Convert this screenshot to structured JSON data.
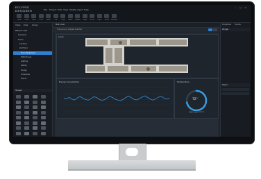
{
  "app": {
    "logo": [
      "ECLYPSE",
      "DESIGNER"
    ],
    "menu": [
      "File",
      "Project",
      "Edit",
      "View",
      "Modify",
      "Insert",
      "Help"
    ],
    "toolbar": [
      {
        "label": "New",
        "icon": "new-file-icon"
      },
      {
        "label": "Open",
        "icon": "open-folder-icon"
      },
      {
        "label": "Save",
        "icon": "save-icon"
      },
      {
        "label": "Undo",
        "icon": "undo-icon"
      },
      {
        "label": "Redo",
        "icon": "redo-icon"
      },
      {
        "label": "Cut",
        "icon": "cut-icon"
      },
      {
        "label": "Copy",
        "icon": "copy-icon"
      },
      {
        "label": "Paste",
        "icon": "paste-icon"
      },
      {
        "label": "Delete",
        "icon": "delete-icon"
      },
      {
        "label": "Align",
        "icon": "align-icon"
      },
      {
        "label": "Group",
        "icon": "group-icon"
      },
      {
        "label": "Layer",
        "icon": "layer-icon"
      },
      {
        "label": "Zoom",
        "icon": "zoom-icon"
      },
      {
        "label": "Preview",
        "icon": "preview-icon"
      }
    ]
  },
  "left_panel": {
    "tabs": [
      "Views",
      "Data",
      "Library"
    ],
    "tree": [
      {
        "label": "Network View",
        "selected": false
      },
      {
        "label": "Overview",
        "selected": false
      },
      {
        "label": "Floors",
        "selected": false
      },
      {
        "label": "1st Floor",
        "selected": false
      },
      {
        "label": "2nd Floor",
        "selected": false
      },
      {
        "label": "Floor Equipment",
        "selected": true
      },
      {
        "label": "HVAC Zones",
        "selected": false
      },
      {
        "label": "Lighting",
        "selected": false
      },
      {
        "label": "Alarms",
        "selected": false
      },
      {
        "label": "Energy",
        "selected": false
      },
      {
        "label": "Schedules",
        "selected": false
      },
      {
        "label": "Trends",
        "selected": false
      }
    ],
    "shapes_title": "Shapes"
  },
  "main": {
    "tab": "Main view",
    "hint": "There are no widgets selected",
    "floorplan_title": "Level",
    "energy_title": "Energy Consumption",
    "temp_title": "Temperature",
    "temp_value": "72°",
    "temp_setpoint_label": "Setpoint",
    "chart_data": {
      "type": "line",
      "title": "Energy Consumption",
      "x": [
        0,
        1,
        2,
        3,
        4,
        5,
        6,
        7,
        8,
        9,
        10,
        11,
        12,
        13,
        14,
        15,
        16,
        17,
        18,
        19,
        20,
        21,
        22,
        23,
        24,
        25,
        26,
        27,
        28,
        29,
        30,
        31,
        32,
        33,
        34,
        35,
        36,
        37,
        38,
        39
      ],
      "series": [
        {
          "values": [
            55,
            52,
            58,
            50,
            47,
            56,
            62,
            54,
            49,
            46,
            52,
            60,
            58,
            50,
            45,
            48,
            55,
            62,
            57,
            50,
            46,
            44,
            50,
            58,
            63,
            56,
            49,
            47,
            53,
            60,
            64,
            57,
            50,
            46,
            52,
            59,
            62,
            55,
            50,
            54
          ]
        }
      ],
      "ylim": [
        0,
        100
      ],
      "grid": true
    },
    "gauge": {
      "value_fraction": 0.72
    }
  },
  "right_panel": {
    "tabs": [
      "Properties",
      "Events"
    ],
    "sections": [
      "Widget",
      "Styles"
    ]
  },
  "colors": {
    "accent": "#2f7fd3",
    "chart_line": "#2f8fd8",
    "gauge_arc": "#3a9be0"
  }
}
